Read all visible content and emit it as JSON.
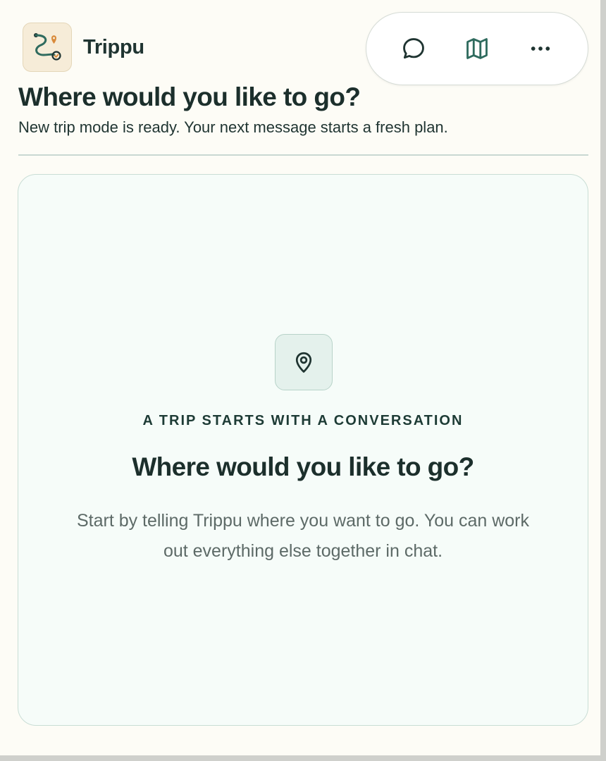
{
  "app": {
    "name": "Trippu"
  },
  "toolbar": {
    "buttons": [
      {
        "icon": "chat-bubble-icon"
      },
      {
        "icon": "map-icon"
      },
      {
        "icon": "more-horizontal-icon"
      }
    ]
  },
  "header": {
    "title": "Where would you like to go?",
    "subtitle": "New trip mode is ready. Your next message starts a fresh plan."
  },
  "empty_state": {
    "icon": "map-pin-icon",
    "eyebrow": "A TRIP STARTS WITH A CONVERSATION",
    "title": "Where would you like to go?",
    "body_lines": [
      "Start by telling Trippu where you want to go. You can work",
      "out everything else together in chat."
    ]
  },
  "colors": {
    "background": "#fdfcf6",
    "text_primary": "#1c2f2c",
    "card_background": "#f6fcf9",
    "accent_green": "#2f6b5e",
    "logo_orange": "#d98a3a"
  }
}
